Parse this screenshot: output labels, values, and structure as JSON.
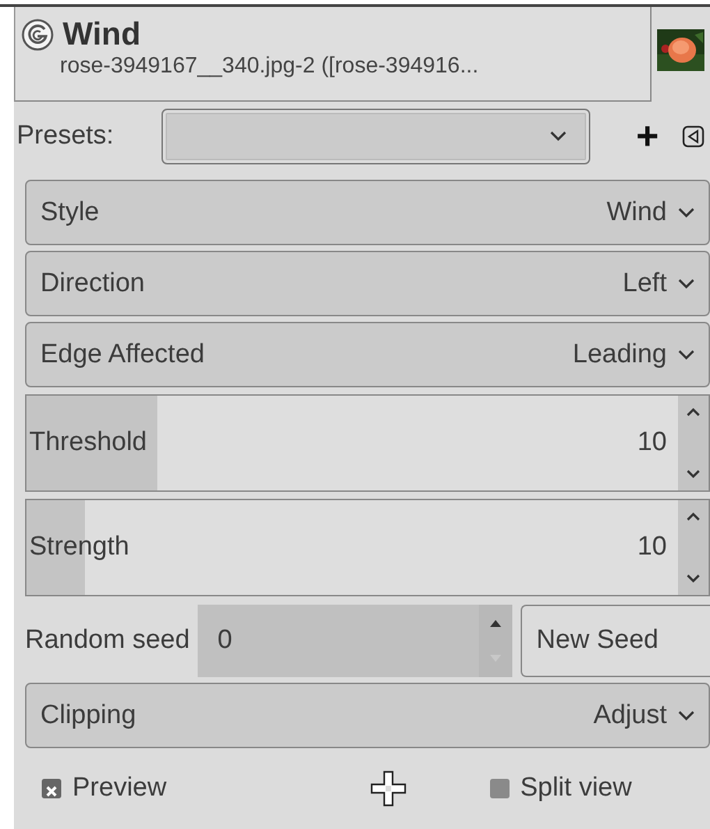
{
  "header": {
    "title": "Wind",
    "subtitle": "rose-3949167__340.jpg-2 ([rose-394916..."
  },
  "presets": {
    "label": "Presets:",
    "add": "+"
  },
  "settings": [
    {
      "kind": "combo",
      "label": "Style",
      "value": "Wind"
    },
    {
      "kind": "combo",
      "label": "Direction",
      "value": "Left"
    },
    {
      "kind": "combo",
      "label": "Edge Affected",
      "value": "Leading"
    },
    {
      "kind": "slider",
      "label": "Threshold",
      "value": "10",
      "level": 0.2
    },
    {
      "kind": "slider",
      "label": "Strength",
      "value": "10",
      "level": 0.09
    }
  ],
  "random_seed": {
    "label": "Random seed",
    "value": "0",
    "button": "New Seed"
  },
  "clipping": {
    "label": "Clipping",
    "value": "Adjust"
  },
  "footer": {
    "preview": {
      "label": "Preview",
      "checked": true
    },
    "split_view": {
      "label": "Split view",
      "checked": false
    }
  }
}
